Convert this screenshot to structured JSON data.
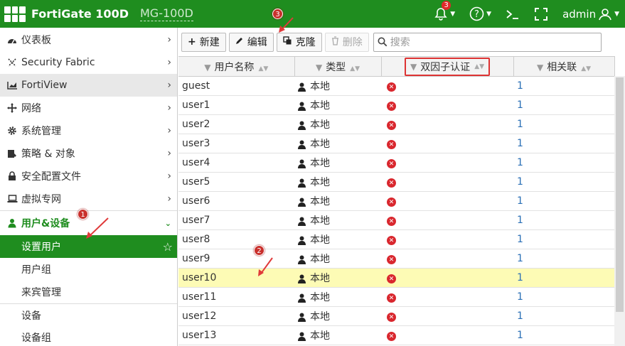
{
  "header": {
    "brand": "FortiGate 100D",
    "host": "MG-100D",
    "notification_count": "3",
    "user": "admin",
    "icons": [
      "bell-icon",
      "help-icon",
      "cli-icon",
      "fullscreen-icon",
      "user-icon"
    ]
  },
  "sidebar": {
    "items": [
      {
        "label": "仪表板",
        "icon": "dashboard-icon"
      },
      {
        "label": "Security Fabric",
        "icon": "fabric-icon"
      },
      {
        "label": "FortiView",
        "icon": "chart-icon"
      },
      {
        "label": "网络",
        "icon": "network-icon"
      },
      {
        "label": "系统管理",
        "icon": "gear-icon"
      },
      {
        "label": "策略 & 对象",
        "icon": "policy-icon"
      },
      {
        "label": "安全配置文件",
        "icon": "lock-icon"
      },
      {
        "label": "虚拟专网",
        "icon": "laptop-icon"
      },
      {
        "label": "用户&设备",
        "icon": "user-icon"
      }
    ],
    "subitems": [
      {
        "label": "设置用户"
      },
      {
        "label": "用户组"
      },
      {
        "label": "来宾管理"
      },
      {
        "label": "设备"
      },
      {
        "label": "设备组"
      }
    ]
  },
  "toolbar": {
    "new": "新建",
    "edit": "编辑",
    "clone": "克隆",
    "delete": "删除",
    "search_placeholder": "搜索"
  },
  "table": {
    "columns": [
      "用户名称",
      "类型",
      "双因子认证",
      "相关联"
    ],
    "rows": [
      {
        "name": "guest",
        "type": "本地",
        "two_factor": "disabled",
        "ref": "1"
      },
      {
        "name": "user1",
        "type": "本地",
        "two_factor": "disabled",
        "ref": "1"
      },
      {
        "name": "user2",
        "type": "本地",
        "two_factor": "disabled",
        "ref": "1"
      },
      {
        "name": "user3",
        "type": "本地",
        "two_factor": "disabled",
        "ref": "1"
      },
      {
        "name": "user4",
        "type": "本地",
        "two_factor": "disabled",
        "ref": "1"
      },
      {
        "name": "user5",
        "type": "本地",
        "two_factor": "disabled",
        "ref": "1"
      },
      {
        "name": "user6",
        "type": "本地",
        "two_factor": "disabled",
        "ref": "1"
      },
      {
        "name": "user7",
        "type": "本地",
        "two_factor": "disabled",
        "ref": "1"
      },
      {
        "name": "user8",
        "type": "本地",
        "two_factor": "disabled",
        "ref": "1"
      },
      {
        "name": "user9",
        "type": "本地",
        "two_factor": "disabled",
        "ref": "1"
      },
      {
        "name": "user10",
        "type": "本地",
        "two_factor": "disabled",
        "ref": "1"
      },
      {
        "name": "user11",
        "type": "本地",
        "two_factor": "disabled",
        "ref": "1"
      },
      {
        "name": "user12",
        "type": "本地",
        "two_factor": "disabled",
        "ref": "1"
      },
      {
        "name": "user13",
        "type": "本地",
        "two_factor": "disabled",
        "ref": "1"
      }
    ],
    "highlighted_row": "user10"
  },
  "annotations": [
    "1",
    "2",
    "3"
  ],
  "colors": {
    "brand_green": "#1f8d1f",
    "highlight_row": "#fdfbb5",
    "annotation_red": "#c9302c",
    "link_blue": "#2a6fb6"
  }
}
